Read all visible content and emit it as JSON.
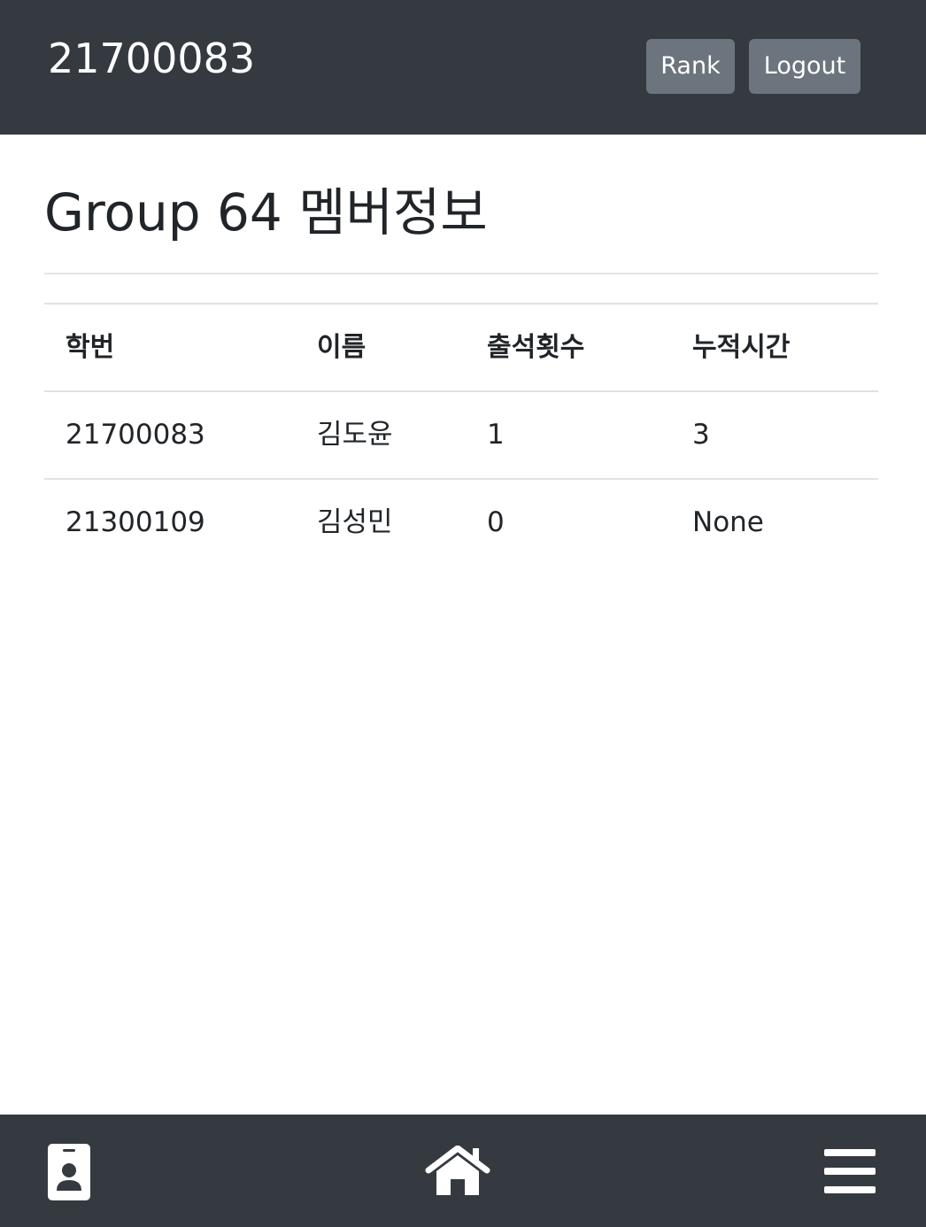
{
  "header": {
    "user_id": "21700083",
    "rank_button": "Rank",
    "logout_button": "Logout"
  },
  "main": {
    "title": "Group 64 멤버정보",
    "table": {
      "columns": [
        "학번",
        "이름",
        "출석횟수",
        "누적시간"
      ],
      "rows": [
        [
          "21700083",
          "김도윤",
          "1",
          "3"
        ],
        [
          "21300109",
          "김성민",
          "0",
          "None"
        ]
      ]
    }
  },
  "bottom_nav": {
    "icons": [
      "id-badge-icon",
      "home-icon",
      "menu-icon"
    ]
  },
  "colors": {
    "navbar_bg": "#343a40",
    "button_bg": "#6c757d",
    "text": "#212529",
    "divider": "#dee2e6"
  }
}
